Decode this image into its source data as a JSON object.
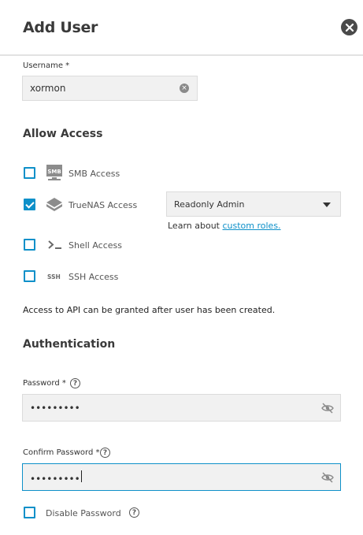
{
  "header": {
    "title": "Add User"
  },
  "username": {
    "label": "Username *",
    "value": "xormon"
  },
  "allow_access": {
    "title": "Allow Access",
    "items": [
      {
        "label": "SMB Access",
        "checked": false,
        "icon": "smb-icon"
      },
      {
        "label": "TrueNAS Access",
        "checked": true,
        "icon": "truenas-icon"
      },
      {
        "label": "Shell Access",
        "checked": false,
        "icon": "shell-icon"
      },
      {
        "label": "SSH Access",
        "checked": false,
        "icon": "ssh-icon"
      }
    ],
    "role_select": {
      "value": "Readonly Admin"
    },
    "learn_prefix": "Learn about",
    "learn_link": "custom roles.",
    "api_note": "Access to API can be granted after user has been created."
  },
  "authentication": {
    "title": "Authentication",
    "password": {
      "label": "Password *",
      "value": "•••••••••"
    },
    "confirm_password": {
      "label": "Confirm Password *",
      "value": "•••••••••"
    },
    "disable_password": {
      "label": "Disable Password",
      "checked": false
    }
  },
  "colors": {
    "accent": "#0e90c9",
    "input_bg": "#f1f1f1",
    "title": "#3a3a3a"
  }
}
